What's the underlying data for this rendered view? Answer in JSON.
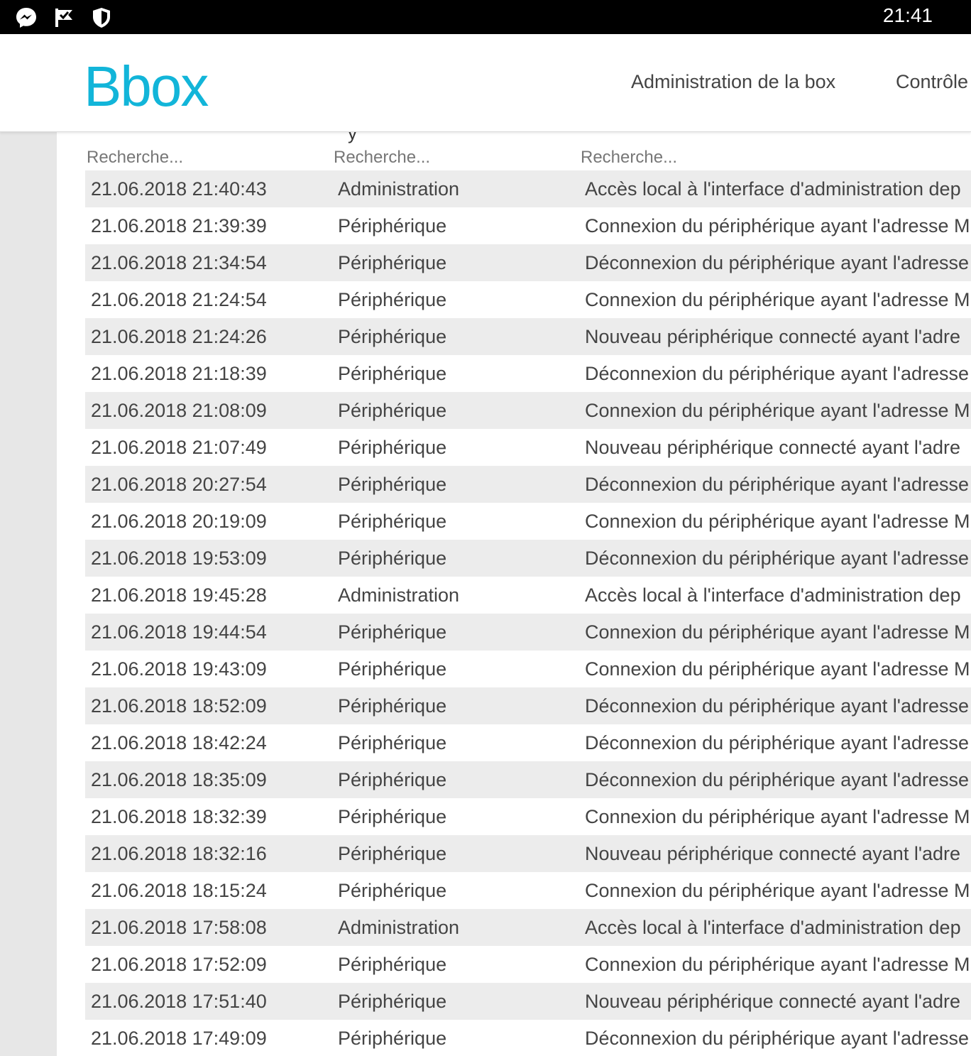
{
  "status_bar": {
    "time": "21:41",
    "icons": [
      "messenger-icon",
      "check-flag-icon",
      "shield-icon"
    ]
  },
  "header": {
    "logo": "Bbox",
    "brand_color": "#12b5d9",
    "nav": [
      "Administration de la box",
      "Contrôle"
    ]
  },
  "section_heading_partial": "y",
  "search": {
    "date_placeholder": "Recherche...",
    "type_placeholder": "Recherche...",
    "description_placeholder": "Recherche..."
  },
  "rows": [
    {
      "date": "21.06.2018 21:40:43",
      "type": "Administration",
      "description": "Accès local à l'interface d'administration dep"
    },
    {
      "date": "21.06.2018 21:39:39",
      "type": "Périphérique",
      "description": "Connexion du périphérique ayant l'adresse M"
    },
    {
      "date": "21.06.2018 21:34:54",
      "type": "Périphérique",
      "description": "Déconnexion du périphérique ayant l'adresse"
    },
    {
      "date": "21.06.2018 21:24:54",
      "type": "Périphérique",
      "description": "Connexion du périphérique ayant l'adresse M"
    },
    {
      "date": "21.06.2018 21:24:26",
      "type": "Périphérique",
      "description": "Nouveau périphérique connecté ayant l'adre"
    },
    {
      "date": "21.06.2018 21:18:39",
      "type": "Périphérique",
      "description": "Déconnexion du périphérique ayant l'adresse"
    },
    {
      "date": "21.06.2018 21:08:09",
      "type": "Périphérique",
      "description": "Connexion du périphérique ayant l'adresse M"
    },
    {
      "date": "21.06.2018 21:07:49",
      "type": "Périphérique",
      "description": "Nouveau périphérique connecté ayant l'adre"
    },
    {
      "date": "21.06.2018 20:27:54",
      "type": "Périphérique",
      "description": "Déconnexion du périphérique ayant l'adresse"
    },
    {
      "date": "21.06.2018 20:19:09",
      "type": "Périphérique",
      "description": "Connexion du périphérique ayant l'adresse M"
    },
    {
      "date": "21.06.2018 19:53:09",
      "type": "Périphérique",
      "description": "Déconnexion du périphérique ayant l'adresse"
    },
    {
      "date": "21.06.2018 19:45:28",
      "type": "Administration",
      "description": "Accès local à l'interface d'administration dep"
    },
    {
      "date": "21.06.2018 19:44:54",
      "type": "Périphérique",
      "description": "Connexion du périphérique ayant l'adresse M"
    },
    {
      "date": "21.06.2018 19:43:09",
      "type": "Périphérique",
      "description": "Connexion du périphérique ayant l'adresse M"
    },
    {
      "date": "21.06.2018 18:52:09",
      "type": "Périphérique",
      "description": "Déconnexion du périphérique ayant l'adresse"
    },
    {
      "date": "21.06.2018 18:42:24",
      "type": "Périphérique",
      "description": "Déconnexion du périphérique ayant l'adresse"
    },
    {
      "date": "21.06.2018 18:35:09",
      "type": "Périphérique",
      "description": "Déconnexion du périphérique ayant l'adresse"
    },
    {
      "date": "21.06.2018 18:32:39",
      "type": "Périphérique",
      "description": "Connexion du périphérique ayant l'adresse M"
    },
    {
      "date": "21.06.2018 18:32:16",
      "type": "Périphérique",
      "description": "Nouveau périphérique connecté ayant l'adre"
    },
    {
      "date": "21.06.2018 18:15:24",
      "type": "Périphérique",
      "description": "Connexion du périphérique ayant l'adresse M"
    },
    {
      "date": "21.06.2018 17:58:08",
      "type": "Administration",
      "description": "Accès local à l'interface d'administration dep"
    },
    {
      "date": "21.06.2018 17:52:09",
      "type": "Périphérique",
      "description": "Connexion du périphérique ayant l'adresse M"
    },
    {
      "date": "21.06.2018 17:51:40",
      "type": "Périphérique",
      "description": "Nouveau périphérique connecté ayant l'adre"
    },
    {
      "date": "21.06.2018 17:49:09",
      "type": "Périphérique",
      "description": "Déconnexion du périphérique ayant l'adresse"
    }
  ]
}
